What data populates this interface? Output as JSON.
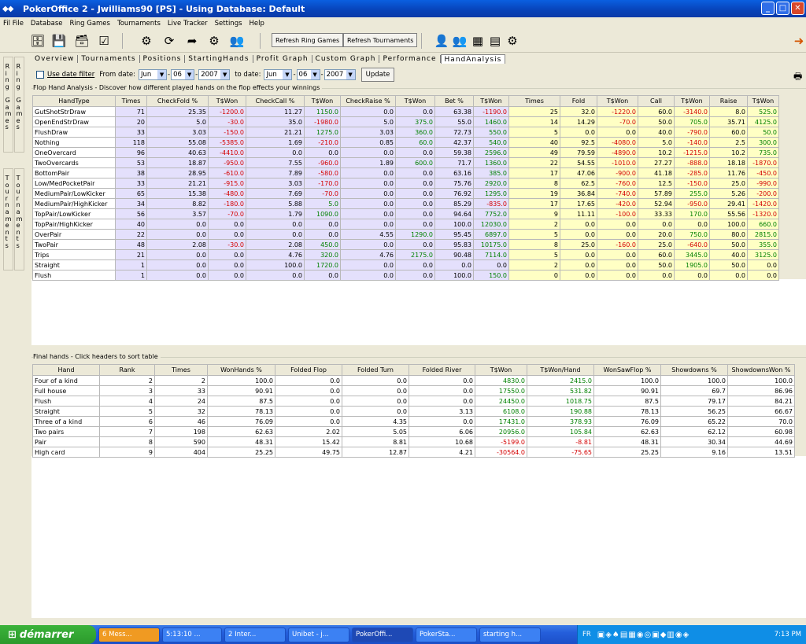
{
  "window": {
    "title": "PokerOffice 2 - Jwilliams90 [PS] - Using Database: Default",
    "icon": "diamond-pair-icon",
    "buttons": [
      "minimize-icon",
      "maximize-icon",
      "close-icon"
    ]
  },
  "menu": [
    "Fil File",
    "Database",
    "Ring Games",
    "Tournaments",
    "Live Tracker",
    "Settings",
    "Help"
  ],
  "toolbar": {
    "refresh_ring": "Refresh Ring Games",
    "refresh_tourn": "Refresh Tournaments"
  },
  "side_tabs": [
    {
      "col1": [
        "R",
        "i",
        "n",
        "g",
        "",
        "G",
        "a",
        "m",
        "e",
        "s"
      ],
      "col2": [
        "R",
        "i",
        "n",
        "g",
        "",
        "G",
        "a",
        "m",
        "e",
        "s"
      ]
    },
    {
      "col1": [
        "T",
        "o",
        "u",
        "r",
        "n",
        "a",
        "m",
        "e",
        "n",
        "t",
        "s"
      ],
      "col2": [
        "T",
        "o",
        "u",
        "r",
        "n",
        "a",
        "m",
        "e",
        "n",
        "t",
        "s"
      ]
    }
  ],
  "subtabs": [
    "Overview",
    "Tournaments",
    "Positions",
    "StartingHands",
    "Profit Graph",
    "Custom Graph",
    "Performance",
    "HandAnalysis"
  ],
  "active_subtab": "HandAnalysis",
  "filter": {
    "use_date": "Use date filter",
    "from_label": "From date:",
    "from": {
      "month": "Jun",
      "day": "06",
      "year": "2007"
    },
    "to_label": "to date:",
    "to": {
      "month": "Jun",
      "day": "06",
      "year": "2007"
    },
    "update": "Update"
  },
  "flop_section": {
    "title": "Flop Hand Analysis - Discover how different played hands on the flop effects your winnings",
    "headers": [
      "HandType",
      "Times",
      "CheckFold %",
      "T$Won",
      "CheckCall %",
      "T$Won",
      "CheckRaise %",
      "T$Won",
      "Bet %",
      "T$Won",
      "Times",
      "Fold",
      "T$Won",
      "Call",
      "T$Won",
      "Raise",
      "T$Won"
    ],
    "rows": [
      [
        "GutShotStrDraw",
        "71",
        "25.35",
        "-1200.0",
        "11.27",
        "1150.0",
        "0.0",
        "0.0",
        "63.38",
        "-1190.0",
        "25",
        "32.0",
        "-1220.0",
        "60.0",
        "-3140.0",
        "8.0",
        "525.0"
      ],
      [
        "OpenEndStrDraw",
        "20",
        "5.0",
        "-30.0",
        "35.0",
        "-1980.0",
        "5.0",
        "375.0",
        "55.0",
        "1460.0",
        "14",
        "14.29",
        "-70.0",
        "50.0",
        "705.0",
        "35.71",
        "4125.0"
      ],
      [
        "FlushDraw",
        "33",
        "3.03",
        "-150.0",
        "21.21",
        "1275.0",
        "3.03",
        "360.0",
        "72.73",
        "550.0",
        "5",
        "0.0",
        "0.0",
        "40.0",
        "-790.0",
        "60.0",
        "50.0"
      ],
      [
        "Nothing",
        "118",
        "55.08",
        "-5385.0",
        "1.69",
        "-210.0",
        "0.85",
        "60.0",
        "42.37",
        "540.0",
        "40",
        "92.5",
        "-4080.0",
        "5.0",
        "-140.0",
        "2.5",
        "300.0"
      ],
      [
        "OneOvercard",
        "96",
        "40.63",
        "-4410.0",
        "0.0",
        "0.0",
        "0.0",
        "0.0",
        "59.38",
        "2596.0",
        "49",
        "79.59",
        "-4890.0",
        "10.2",
        "-1215.0",
        "10.2",
        "735.0"
      ],
      [
        "TwoOvercards",
        "53",
        "18.87",
        "-950.0",
        "7.55",
        "-960.0",
        "1.89",
        "600.0",
        "71.7",
        "1360.0",
        "22",
        "54.55",
        "-1010.0",
        "27.27",
        "-888.0",
        "18.18",
        "-1870.0"
      ],
      [
        "BottomPair",
        "38",
        "28.95",
        "-610.0",
        "7.89",
        "-580.0",
        "0.0",
        "0.0",
        "63.16",
        "385.0",
        "17",
        "47.06",
        "-900.0",
        "41.18",
        "-285.0",
        "11.76",
        "-450.0"
      ],
      [
        "Low/MedPocketPair",
        "33",
        "21.21",
        "-915.0",
        "3.03",
        "-170.0",
        "0.0",
        "0.0",
        "75.76",
        "2920.0",
        "8",
        "62.5",
        "-760.0",
        "12.5",
        "-150.0",
        "25.0",
        "-990.0"
      ],
      [
        "MediumPair/LowKicker",
        "65",
        "15.38",
        "-480.0",
        "7.69",
        "-70.0",
        "0.0",
        "0.0",
        "76.92",
        "1295.0",
        "19",
        "36.84",
        "-740.0",
        "57.89",
        "255.0",
        "5.26",
        "-200.0"
      ],
      [
        "MediumPair/HighKicker",
        "34",
        "8.82",
        "-180.0",
        "5.88",
        "5.0",
        "0.0",
        "0.0",
        "85.29",
        "-835.0",
        "17",
        "17.65",
        "-420.0",
        "52.94",
        "-950.0",
        "29.41",
        "-1420.0"
      ],
      [
        "TopPair/LowKicker",
        "56",
        "3.57",
        "-70.0",
        "1.79",
        "1090.0",
        "0.0",
        "0.0",
        "94.64",
        "7752.0",
        "9",
        "11.11",
        "-100.0",
        "33.33",
        "170.0",
        "55.56",
        "-1320.0"
      ],
      [
        "TopPair/HighKicker",
        "40",
        "0.0",
        "0.0",
        "0.0",
        "0.0",
        "0.0",
        "0.0",
        "100.0",
        "12030.0",
        "2",
        "0.0",
        "0.0",
        "0.0",
        "0.0",
        "100.0",
        "660.0"
      ],
      [
        "OverPair",
        "22",
        "0.0",
        "0.0",
        "0.0",
        "0.0",
        "4.55",
        "1290.0",
        "95.45",
        "6897.0",
        "5",
        "0.0",
        "0.0",
        "20.0",
        "750.0",
        "80.0",
        "2815.0"
      ],
      [
        "TwoPair",
        "48",
        "2.08",
        "-30.0",
        "2.08",
        "450.0",
        "0.0",
        "0.0",
        "95.83",
        "10175.0",
        "8",
        "25.0",
        "-160.0",
        "25.0",
        "-640.0",
        "50.0",
        "355.0"
      ],
      [
        "Trips",
        "21",
        "0.0",
        "0.0",
        "4.76",
        "320.0",
        "4.76",
        "2175.0",
        "90.48",
        "7114.0",
        "5",
        "0.0",
        "0.0",
        "60.0",
        "3445.0",
        "40.0",
        "3125.0"
      ],
      [
        "Straight",
        "1",
        "0.0",
        "0.0",
        "100.0",
        "1720.0",
        "0.0",
        "0.0",
        "0.0",
        "0.0",
        "2",
        "0.0",
        "0.0",
        "50.0",
        "1905.0",
        "50.0",
        "0.0"
      ],
      [
        "Flush",
        "1",
        "0.0",
        "0.0",
        "0.0",
        "0.0",
        "0.0",
        "0.0",
        "100.0",
        "150.0",
        "0",
        "0.0",
        "0.0",
        "0.0",
        "0.0",
        "0.0",
        "0.0"
      ]
    ]
  },
  "final_section": {
    "title": "Final hands - Click headers to sort table",
    "headers": [
      "Hand",
      "Rank",
      "Times",
      "WonHands %",
      "Folded Flop",
      "Folded Turn",
      "Folded River",
      "T$Won",
      "T$Won/Hand",
      "WonSawFlop %",
      "Showdowns %",
      "ShowdownsWon %"
    ],
    "rows": [
      [
        "Four of a kind",
        "2",
        "2",
        "100.0",
        "0.0",
        "0.0",
        "0.0",
        "4830.0",
        "2415.0",
        "100.0",
        "100.0",
        "100.0"
      ],
      [
        "Full house",
        "3",
        "33",
        "90.91",
        "0.0",
        "0.0",
        "0.0",
        "17550.0",
        "531.82",
        "90.91",
        "69.7",
        "86.96"
      ],
      [
        "Flush",
        "4",
        "24",
        "87.5",
        "0.0",
        "0.0",
        "0.0",
        "24450.0",
        "1018.75",
        "87.5",
        "79.17",
        "84.21"
      ],
      [
        "Straight",
        "5",
        "32",
        "78.13",
        "0.0",
        "0.0",
        "3.13",
        "6108.0",
        "190.88",
        "78.13",
        "56.25",
        "66.67"
      ],
      [
        "Three of a kind",
        "6",
        "46",
        "76.09",
        "0.0",
        "4.35",
        "0.0",
        "17431.0",
        "378.93",
        "76.09",
        "65.22",
        "70.0"
      ],
      [
        "Two pairs",
        "7",
        "198",
        "62.63",
        "2.02",
        "5.05",
        "6.06",
        "20956.0",
        "105.84",
        "62.63",
        "62.12",
        "60.98"
      ],
      [
        "Pair",
        "8",
        "590",
        "48.31",
        "15.42",
        "8.81",
        "10.68",
        "-5199.0",
        "-8.81",
        "48.31",
        "30.34",
        "44.69"
      ],
      [
        "High card",
        "9",
        "404",
        "25.25",
        "49.75",
        "12.87",
        "4.21",
        "-30564.0",
        "-75.65",
        "25.25",
        "9.16",
        "13.51"
      ]
    ]
  },
  "taskbar": {
    "start": "démarrer",
    "tasks": [
      "6 Mess...",
      "5:13:10 ...",
      "2 Inter...",
      "Unibet - j...",
      "PokerOffi...",
      "PokerSta...",
      "starting h..."
    ],
    "lang": "FR",
    "clock": "7:13 PM"
  }
}
